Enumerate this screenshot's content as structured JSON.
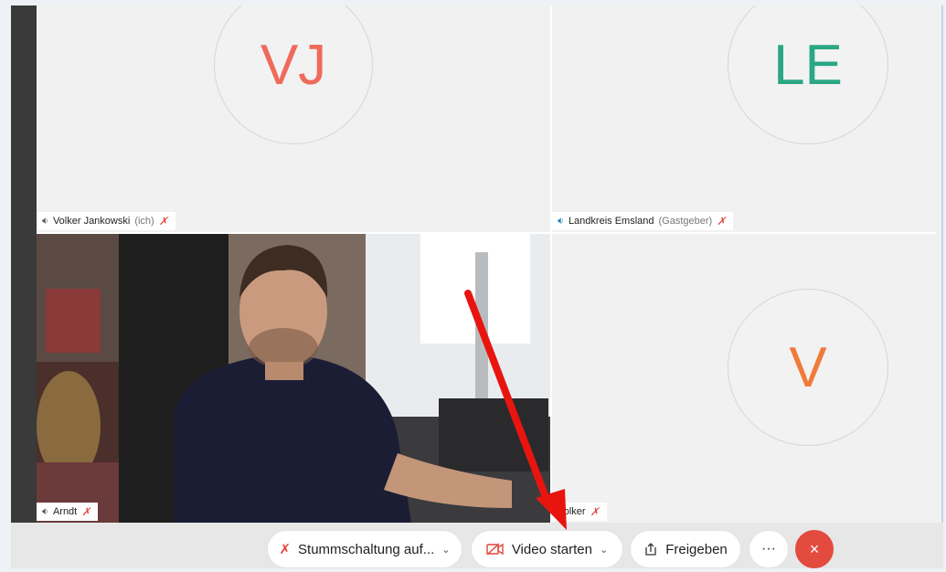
{
  "participants": [
    {
      "initials": "VJ",
      "name": "Volker Jankowski",
      "suffix": "(ich)",
      "initials_color": "#ef6a5b"
    },
    {
      "initials": "LE",
      "name": "Landkreis Emsland",
      "suffix": "(Gastgeber)",
      "initials_color": "#2aa784"
    },
    {
      "name": "Arndt"
    },
    {
      "initials": "V",
      "name": "Volker",
      "initials_color": "#f07a39"
    }
  ],
  "toolbar": {
    "mute_label": "Stummschaltung auf...",
    "video_label": "Video starten",
    "share_label": "Freigeben",
    "more_label": "···",
    "end_label": "×"
  },
  "icons": {
    "mic_muted": "mic-muted-icon",
    "video_off": "video-off-icon",
    "share": "share-icon",
    "speaker": "speaker-icon",
    "annotation_arrow": "red-arrow"
  },
  "colors": {
    "end_call": "#e44b3f",
    "muted_red": "#e0443a",
    "annotation": "#e8150f"
  }
}
